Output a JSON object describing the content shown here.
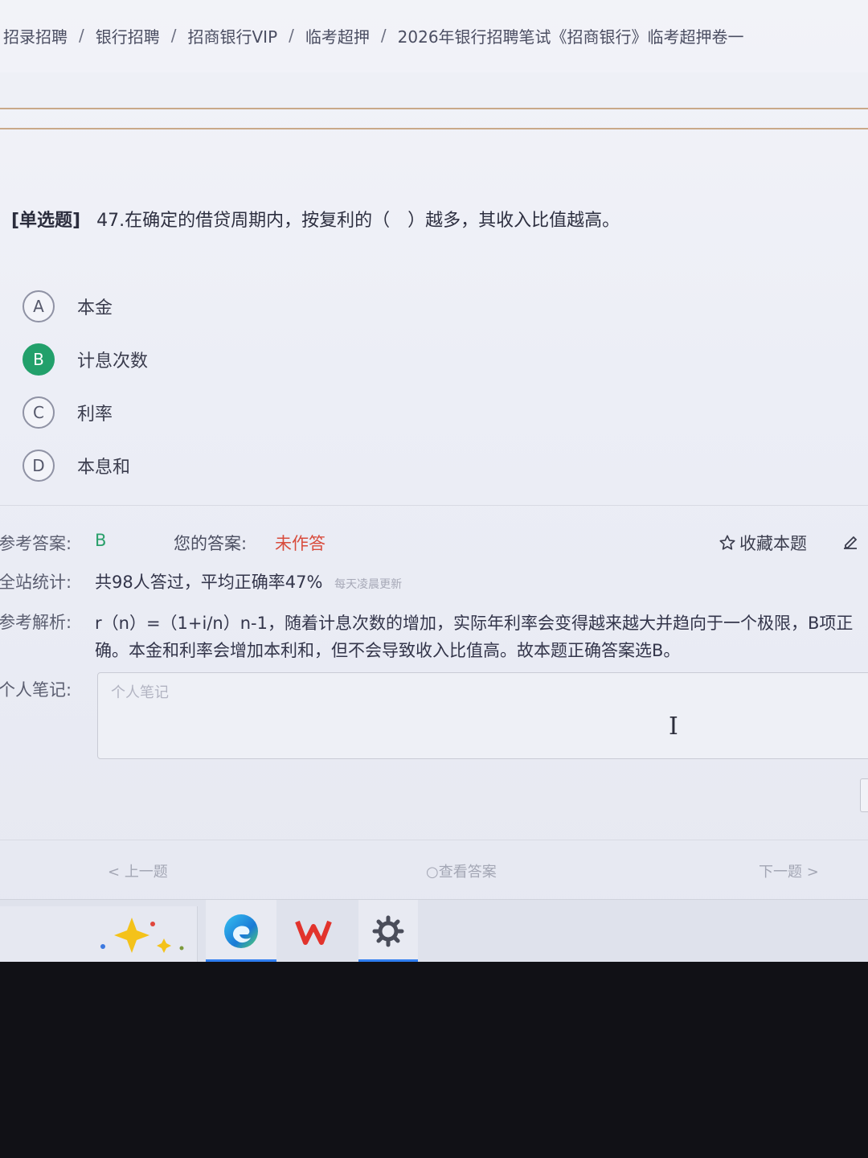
{
  "breadcrumb": [
    "招录招聘",
    "银行招聘",
    "招商银行VIP",
    "临考超押",
    "2026年银行招聘笔试《招商银行》临考超押卷一"
  ],
  "question": {
    "type": "[单选题]",
    "text": "47.在确定的借贷周期内，按复利的（　）越多，其收入比值越高。"
  },
  "options": [
    {
      "letter": "A",
      "text": "本金",
      "selected": false
    },
    {
      "letter": "B",
      "text": "计息次数",
      "selected": true
    },
    {
      "letter": "C",
      "text": "利率",
      "selected": false
    },
    {
      "letter": "D",
      "text": "本息和",
      "selected": false
    }
  ],
  "answer": {
    "ref_label": "参考答案:",
    "ref_value": "B",
    "your_label": "您的答案:",
    "your_value": "未作答",
    "favorite": "收藏本题"
  },
  "stats": {
    "label": "全站统计:",
    "value": "共98人答过，平均正确率47%",
    "note": "每天凌晨更新"
  },
  "analysis": {
    "label": "参考解析:",
    "text": "r（n）=（1+i/n）n-1，随着计息次数的增加，实际年利率会变得越来越大并趋向于一个极限，B项正确。本金和利率会增加本利和，但不会导致收入比值高。故本题正确答案选B。"
  },
  "note": {
    "label": "个人笔记:",
    "placeholder": "个人笔记"
  },
  "nav": {
    "prev": "上一题",
    "view": "查看答案",
    "next": "下一题"
  },
  "taskbar": {
    "apps": [
      "copilot-icon",
      "edge-icon",
      "wps-icon",
      "settings-icon"
    ]
  },
  "colors": {
    "correct": "#22a06b",
    "unanswered": "#d84b3c",
    "taskbar_active": "#2f7ef0"
  }
}
